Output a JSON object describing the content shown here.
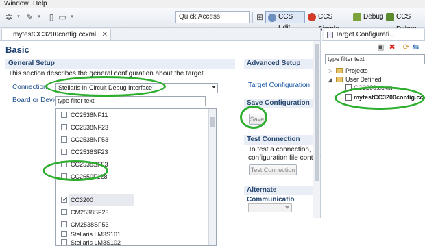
{
  "menubar": {
    "items": [
      "Window",
      "Help"
    ]
  },
  "toolbar": {
    "quick_access": "Quick Access",
    "perspectives": [
      {
        "label": "CCS Edit",
        "active": true,
        "icon": "ccs-edit-icon"
      },
      {
        "label": "CCS Simple",
        "active": false,
        "icon": "ccs-simple-icon"
      },
      {
        "label": "Debug",
        "active": false,
        "icon": "debug-icon"
      },
      {
        "label": "CCS Debug",
        "active": false,
        "icon": "ccs-debug-icon"
      }
    ]
  },
  "editor": {
    "tab_title": "mytestCC3200config.ccxml",
    "page_title": "Basic",
    "general_setup": {
      "heading": "General Setup",
      "description": "This section describes the general configuration about the target.",
      "connection_label": "Connection",
      "connection_value": "Stellaris In-Circuit Debug Interface",
      "board_label": "Board or Device",
      "filter_placeholder": "type filter text",
      "devices": [
        {
          "label": "CC2538NF11",
          "checked": false
        },
        {
          "label": "CC2538NF23",
          "checked": false
        },
        {
          "label": "CC2538NF53",
          "checked": false
        },
        {
          "label": "CC2538SF23",
          "checked": false
        },
        {
          "label": "CC2538SF53",
          "checked": false
        },
        {
          "label": "CC2650F128",
          "checked": false
        },
        {
          "label": "CC3200",
          "checked": true
        },
        {
          "label": "CM2538SF23",
          "checked": false
        },
        {
          "label": "CM2538SF53",
          "checked": false
        },
        {
          "label": "Stellaris LM3S101",
          "checked": false
        },
        {
          "label": "Stellaris LM3S102",
          "checked": false
        }
      ]
    },
    "advanced_setup": {
      "heading": "Advanced Setup",
      "link": "Target Configuration",
      "link_suffix": ": lis"
    },
    "save_configuration": {
      "heading": "Save Configuration",
      "button": "Save"
    },
    "test_connection": {
      "heading": "Test Connection",
      "text1": "To test a connection, all",
      "text2": "configuration file contair",
      "button": "Test Connection"
    },
    "alternate": {
      "heading": "Alternate Communicatio"
    }
  },
  "target_panel": {
    "tab_title": "Target Configurati...",
    "filter_placeholder": "type filter text",
    "tree": [
      {
        "label": "Projects",
        "level": 0
      },
      {
        "label": "User Defined",
        "level": 0
      },
      {
        "label": "CC3200.ccxml",
        "level": 1
      },
      {
        "label": "mytestCC3200config.ccxml",
        "level": 1
      }
    ]
  },
  "colors": {
    "highlight": "#2eae2e",
    "accent": "#1f4f8a"
  }
}
